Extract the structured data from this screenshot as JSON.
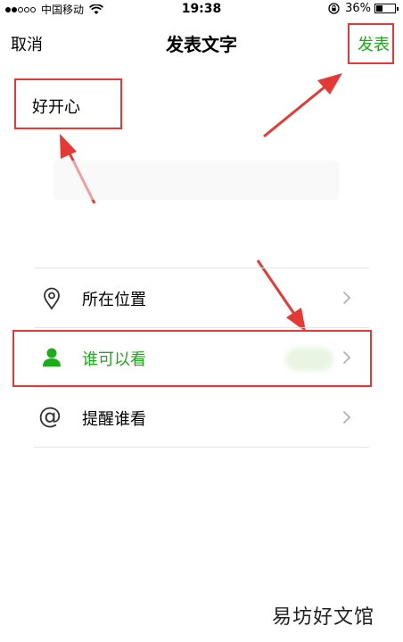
{
  "status_bar": {
    "carrier": "中国移动",
    "time": "19:38",
    "battery": "36%",
    "battery_level_percent": 36
  },
  "nav": {
    "cancel_label": "取消",
    "title": "发表文字",
    "post_label": "发表"
  },
  "compose": {
    "text": "好开心"
  },
  "options": [
    {
      "label": "所在位置",
      "icon": "location-pin-icon"
    },
    {
      "label": "谁可以看",
      "icon": "person-icon"
    },
    {
      "label": "提醒谁看",
      "icon": "at-sign-icon"
    }
  ],
  "watermark": "易坊好文馆",
  "colors": {
    "accent_green": "#1aad19",
    "annotation_red": "#e53935",
    "divider": "#e5e5e5"
  }
}
